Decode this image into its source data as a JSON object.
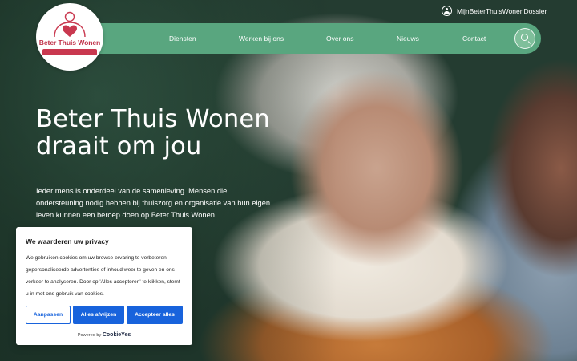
{
  "brand": {
    "name": "Beter Thuis Wonen",
    "accent": "#c9384f",
    "nav_green": "#59a67f"
  },
  "top_link": {
    "label": "MijnBeterThuisWonenDossier",
    "icon": "user-circle-icon"
  },
  "nav": {
    "items": [
      {
        "label": "Diensten"
      },
      {
        "label": "Werken bij ons"
      },
      {
        "label": "Over ons"
      },
      {
        "label": "Nieuws"
      },
      {
        "label": "Contact"
      }
    ],
    "search_icon": "search-icon"
  },
  "hero": {
    "title_line1": "Beter Thuis Wonen",
    "title_line2": "draait om jou",
    "text": "Ieder mens is onderdeel van de samenleving. Mensen die ondersteuning nodig hebben bij thuiszorg en organisatie van hun eigen leven kunnen een beroep doen op Beter Thuis Wonen."
  },
  "cookie": {
    "title": "We waarderen uw privacy",
    "text": "We gebruiken cookies om uw browse-ervaring te verbeteren, gepersonaliseerde advertenties of inhoud weer te geven en ons verkeer te analyseren. Door op 'Alles accepteren' te klikken, stemt u in met ons gebruik van cookies.",
    "btn_customize": "Aanpassen",
    "btn_reject": "Alles afwijzen",
    "btn_accept": "Accepteer alles",
    "powered_by": "Powered by",
    "powered_brand": "CookieYes",
    "button_color": "#1863dc"
  }
}
